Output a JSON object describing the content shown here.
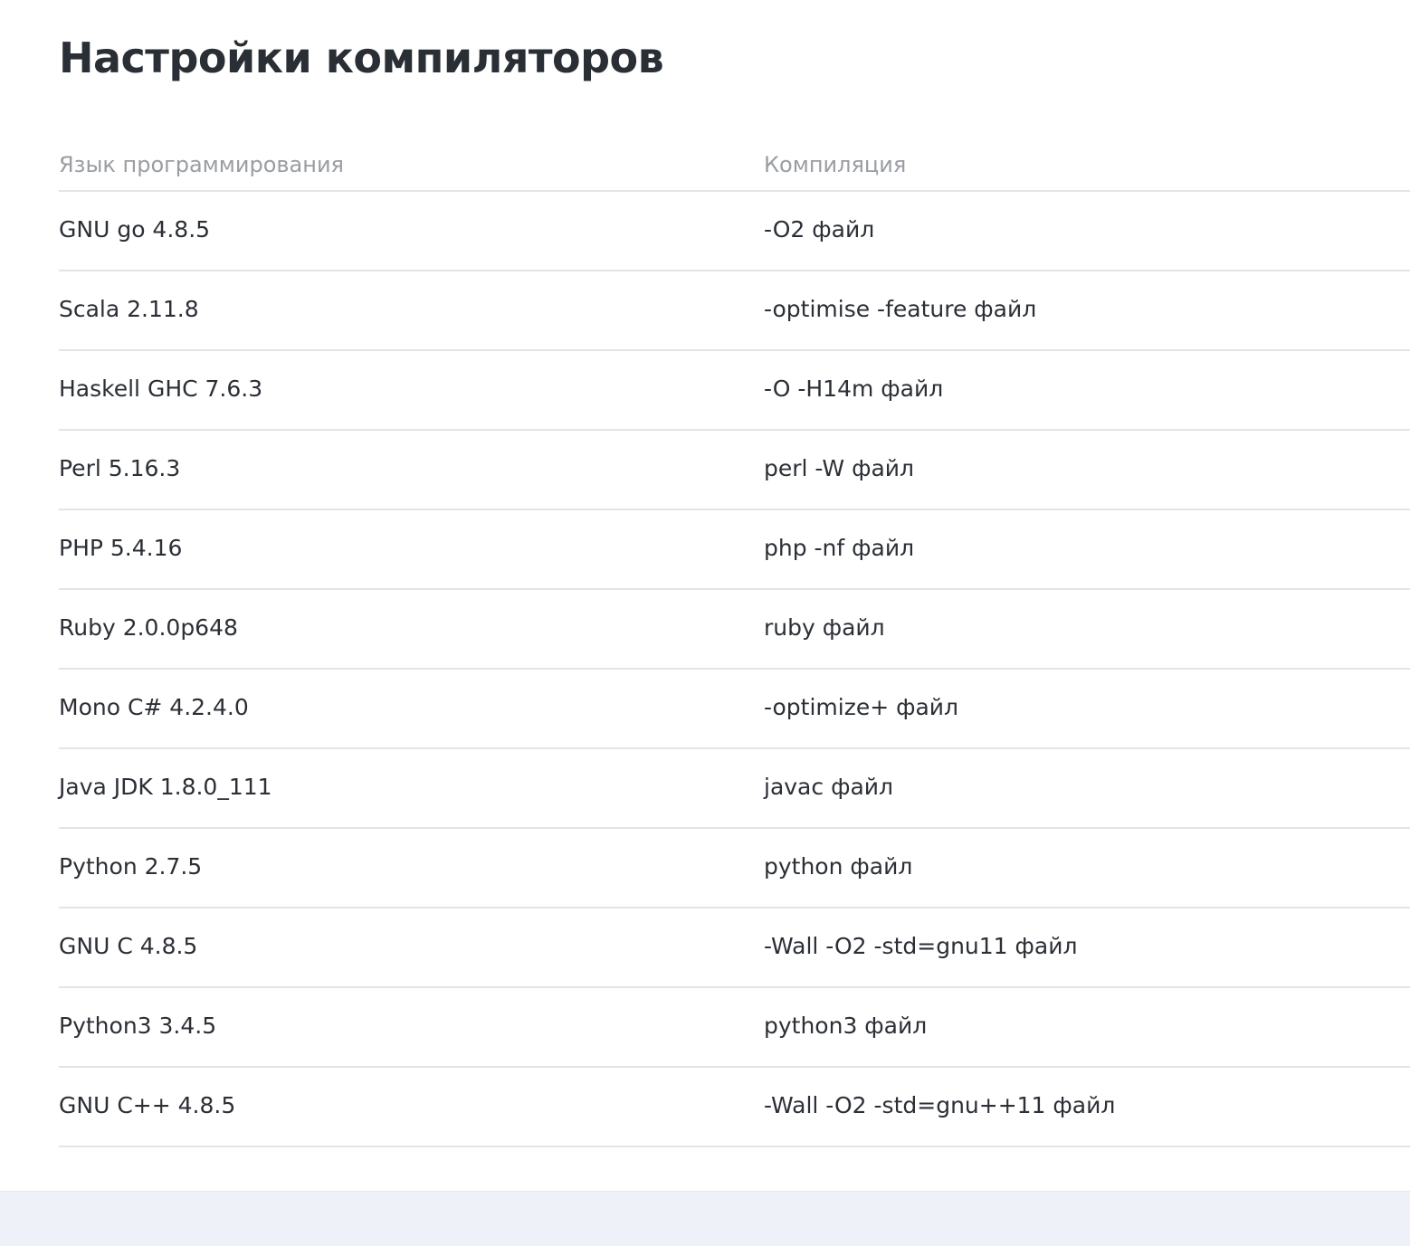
{
  "page": {
    "title": "Настройки компиляторов"
  },
  "table": {
    "headers": {
      "language": "Язык программирования",
      "compilation": "Компиляция"
    },
    "rows": [
      {
        "language": "GNU go 4.8.5",
        "compilation": "-O2 файл"
      },
      {
        "language": "Scala 2.11.8",
        "compilation": "-optimise -feature файл"
      },
      {
        "language": "Haskell GHC 7.6.3",
        "compilation": "-O -H14m файл"
      },
      {
        "language": "Perl 5.16.3",
        "compilation": "perl -W файл"
      },
      {
        "language": "PHP 5.4.16",
        "compilation": "php -nf файл"
      },
      {
        "language": "Ruby 2.0.0p648",
        "compilation": "ruby файл"
      },
      {
        "language": "Mono C# 4.2.4.0",
        "compilation": "-optimize+ файл"
      },
      {
        "language": "Java JDK 1.8.0_111",
        "compilation": "javac файл"
      },
      {
        "language": "Python 2.7.5",
        "compilation": "python файл"
      },
      {
        "language": "GNU C 4.8.5",
        "compilation": "-Wall -O2 -std=gnu11 файл"
      },
      {
        "language": "Python3 3.4.5",
        "compilation": "python3 файл"
      },
      {
        "language": "GNU C++ 4.8.5",
        "compilation": "-Wall -O2 -std=gnu++11 файл"
      }
    ]
  },
  "colors": {
    "text": "#2b2f36",
    "header_text": "#9a9da3",
    "divider": "#e2e4e8",
    "footer_bg": "#eef1f8"
  }
}
